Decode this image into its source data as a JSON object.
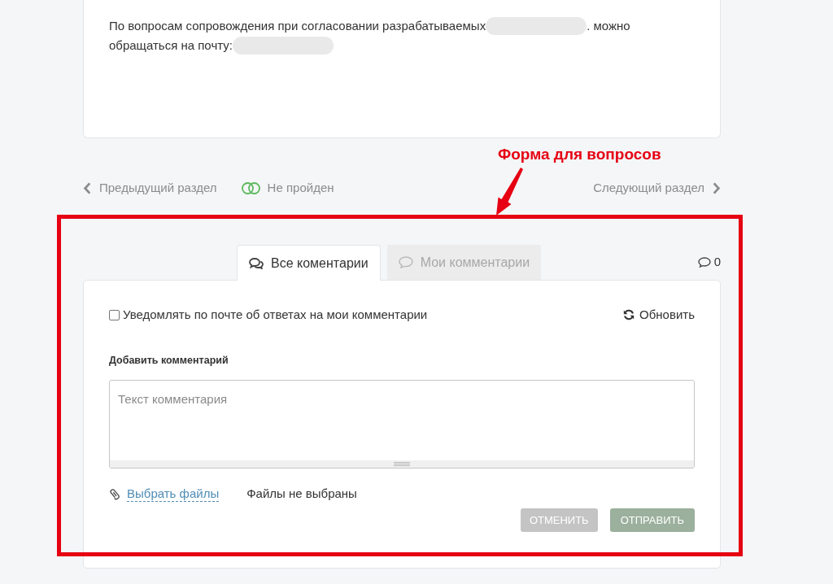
{
  "info_card": {
    "lines": [
      [
        {
          "kind": "text",
          "text": "По вопросам сопровождения при согласовании разрабатываемых"
        },
        {
          "kind": "redacted"
        },
        {
          "kind": "text",
          "text": ". можно"
        }
      ],
      [
        {
          "kind": "text",
          "text": "обращаться на почту:"
        },
        {
          "kind": "redacted"
        }
      ]
    ]
  },
  "annotation": {
    "label": "Форма для вопросов"
  },
  "section_nav": {
    "previous": "Предыдущий раздел",
    "status": "Не пройден",
    "next": "Следующий раздел"
  },
  "tabs": [
    {
      "label": "Все коментарии",
      "selected": true
    },
    {
      "label": "Мои комментарии",
      "selected": false
    }
  ],
  "comment_count": "0",
  "notify_checkbox": {
    "label": "Уведомлять по почте об ответах на мои комментарии",
    "checked": false
  },
  "refresh_button": "Обновить",
  "add_comment": {
    "heading": "Добавить комментарий",
    "placeholder": "Текст комментария"
  },
  "files": {
    "link": "Выбрать файлы",
    "status": "Файлы не выбраны"
  },
  "buttons": [
    {
      "label": "ОТМЕНИТЬ",
      "kind": "cancel"
    },
    {
      "label": "ОТПРАВИТЬ",
      "kind": "submit"
    }
  ]
}
